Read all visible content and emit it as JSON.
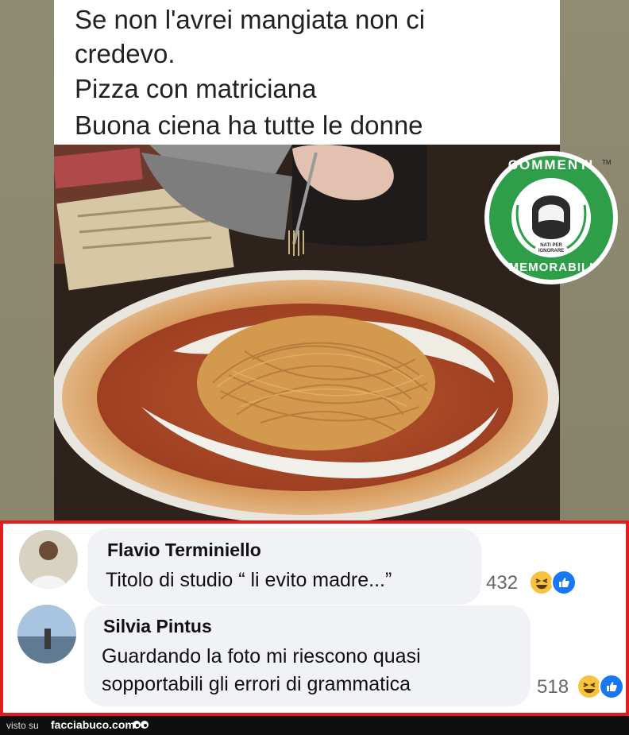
{
  "caption": {
    "lines": [
      "Se non l'avrei mangiata non ci",
      "credevo.",
      "Pizza con matriciana",
      "Buona ciena ha tutte le donne"
    ]
  },
  "logo": {
    "top_text": "COMMENTI",
    "bottom_text": "MEMORABILI",
    "tagline_1": "NATI PER",
    "tagline_2": "IGNORARE",
    "trademark": "TM",
    "brand_color": "#2e9e48"
  },
  "comments": [
    {
      "author": "Flavio Terminiello",
      "text": "Titolo di studio “ li evito madre...”",
      "reactions": "432"
    },
    {
      "author": "Silvia Pintus",
      "text_line_1": "Guardando la foto mi riescono quasi",
      "text_line_2": "sopportabili gli errori di grammatica",
      "reactions": "518"
    }
  ],
  "footer": {
    "visto": "visto su",
    "site": "facciabuco.com"
  },
  "colors": {
    "frame_red": "#e11b22",
    "bubble": "#f0f2f5",
    "like_blue": "#1877f2",
    "haha_yellow": "#f7c33e"
  }
}
